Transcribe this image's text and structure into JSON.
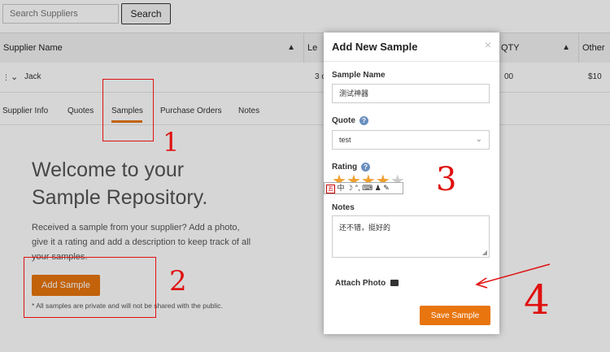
{
  "search": {
    "placeholder": "Search Suppliers",
    "button": "Search"
  },
  "table": {
    "headers": [
      "Supplier Name",
      "Le",
      "QTY",
      "Other"
    ],
    "row": {
      "name": "Jack",
      "col2": "3 c",
      "qty": "00",
      "other": "$10"
    }
  },
  "tabs": [
    "Supplier Info",
    "Quotes",
    "Samples",
    "Purchase Orders",
    "Notes"
  ],
  "active_tab": "Samples",
  "welcome": {
    "title_line1": "Welcome to your",
    "title_line2": "Sample Repository.",
    "description": "Received a sample from your supplier? Add a photo, give it a rating and add a description to keep track of all your samples.",
    "add_button": "Add Sample",
    "private_note": "* All samples are private and will not be shared with the public."
  },
  "modal": {
    "title": "Add New Sample",
    "close": "×",
    "sample_name_label": "Sample Name",
    "sample_name_value": "测试神器",
    "quote_label": "Quote",
    "quote_value": "test",
    "rating_label": "Rating",
    "rating": 4,
    "rating_max": 5,
    "notes_label": "Notes",
    "notes_value": "还不错，挺好的",
    "attach_label": "Attach Photo",
    "save_button": "Save Sample"
  },
  "ime_toolbar": "中 ☽ °, ⌨ ♟ ✎",
  "annotations": {
    "n1": "1",
    "n2": "2",
    "n3": "3",
    "n4": "4"
  },
  "colors": {
    "accent": "#e8750e",
    "annotation": "#e01010",
    "star_filled": "#f0a030",
    "star_empty": "#cccccc"
  }
}
